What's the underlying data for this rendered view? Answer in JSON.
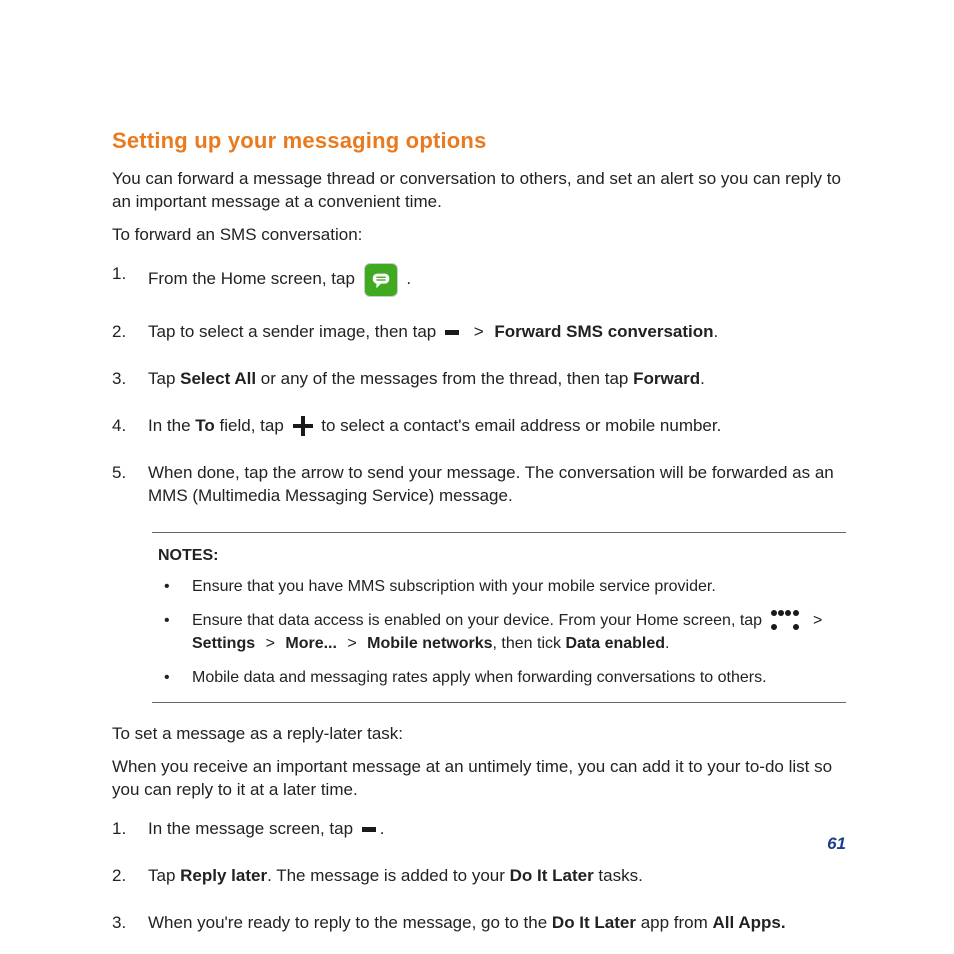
{
  "title": "Setting up your messaging options",
  "intro1": "You can forward a message thread or conversation to others, and set an alert so you can reply to  an important message at a convenient time.",
  "intro2": "To forward an SMS conversation:",
  "steps1": {
    "n1": "1.",
    "n2": "2.",
    "n3": "3.",
    "n4": "4.",
    "n5": "5.",
    "s1_a": "From the Home screen, tap ",
    "s1_b": " .",
    "s2_a": "Tap to select a sender image, then tap ",
    "s2_c": "Forward SMS conversation",
    "s2_d": ".",
    "s3_a": "Tap ",
    "s3_b": "Select All",
    "s3_c": " or any of the messages from the thread, then tap ",
    "s3_d": "Forward",
    "s3_e": ".",
    "s4_a": "In the ",
    "s4_b": "To",
    "s4_c": " field, tap ",
    "s4_d": " to select a contact's email address or mobile number.",
    "s5": "When done, tap the arrow to send your message. The conversation will be forwarded as an MMS (Multimedia Messaging Service) message."
  },
  "notes": {
    "title": "NOTES:",
    "n1": "Ensure that you have MMS subscription with your mobile service provider.",
    "n2_a": "Ensure that data access is enabled on your device. From your Home screen, tap ",
    "n2_c": "Settings",
    "n2_e": "More...",
    "n2_g": "Mobile networks",
    "n2_h": ", then tick ",
    "n2_i": "Data enabled",
    "n2_j": ".",
    "n3": "Mobile data and messaging rates apply when forwarding conversations to others."
  },
  "gt": " > ",
  "subhead1": "To set a message as a reply-later task:",
  "subhead2": "When you receive an important message at an untimely time, you can add it to your to-do list so you can reply to it at a later time.",
  "steps2": {
    "n1": "1.",
    "n2": "2.",
    "n3": "3.",
    "s1_a": "In the message screen, tap ",
    "s1_b": ".",
    "s2_a": "Tap ",
    "s2_b": "Reply later",
    "s2_c": ". The message is added to your ",
    "s2_d": "Do It Later",
    "s2_e": " tasks.",
    "s3_a": "When you're ready to reply to the message, go to the ",
    "s3_b": "Do It Later",
    "s3_c": " app from ",
    "s3_d": "All Apps."
  },
  "page_number": "61"
}
